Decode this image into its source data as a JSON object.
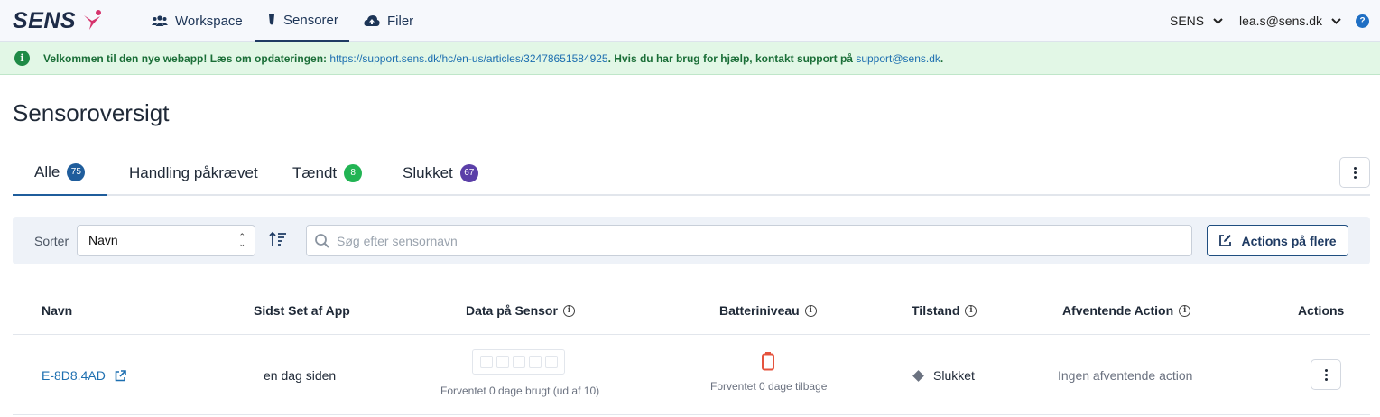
{
  "brand": {
    "logo_text": "SENS"
  },
  "nav": {
    "tabs": [
      {
        "label": "Workspace",
        "icon": "people-group-icon"
      },
      {
        "label": "Sensorer",
        "icon": "sensor-icon",
        "active": true
      },
      {
        "label": "Filer",
        "icon": "cloud-upload-icon"
      }
    ],
    "org_label": "SENS",
    "user_label": "lea.s@sens.dk",
    "help_label": "?"
  },
  "banner": {
    "icon": "info-icon",
    "prefix": "Velkommen til den nye webapp! Læs om opdateringen:",
    "link": "https://support.sens.dk/hc/en-us/articles/32478651584925",
    "middle": ". Hvis du har brug for hjælp, kontakt support på",
    "email": "support@sens.dk",
    "suffix": "."
  },
  "page": {
    "title": "Sensoroversigt"
  },
  "tabs": [
    {
      "label": "Alle",
      "count": "75",
      "badge_color": "#1f5d9c",
      "active": true
    },
    {
      "label": "Handling påkrævet",
      "count": null
    },
    {
      "label": "Tændt",
      "count": "8",
      "badge_color": "#22b454"
    },
    {
      "label": "Slukket",
      "count": "67",
      "badge_color": "#5b3fa8"
    }
  ],
  "toolbar": {
    "sort_label": "Sorter",
    "sort_value": "Navn",
    "search_placeholder": "Søg efter sensornavn",
    "actions_label": "Actions på flere"
  },
  "table": {
    "columns": [
      "Navn",
      "Sidst Set af App",
      "Data på Sensor",
      "Batteriniveau",
      "Tilstand",
      "Afventende Action",
      "Actions"
    ],
    "rows": [
      {
        "name": "E-8D8.4AD",
        "last_seen": "en dag siden",
        "data_caption": "Forventet 0 dage brugt (ud af 10)",
        "battery_caption": "Forventet 0 dage tilbage",
        "state": "Slukket",
        "pending_action": "Ingen afventende action"
      }
    ]
  },
  "colors": {
    "accent": "#1f5d9c",
    "banner_bg": "#e2f7e6",
    "battery_low": "#e5533d"
  }
}
